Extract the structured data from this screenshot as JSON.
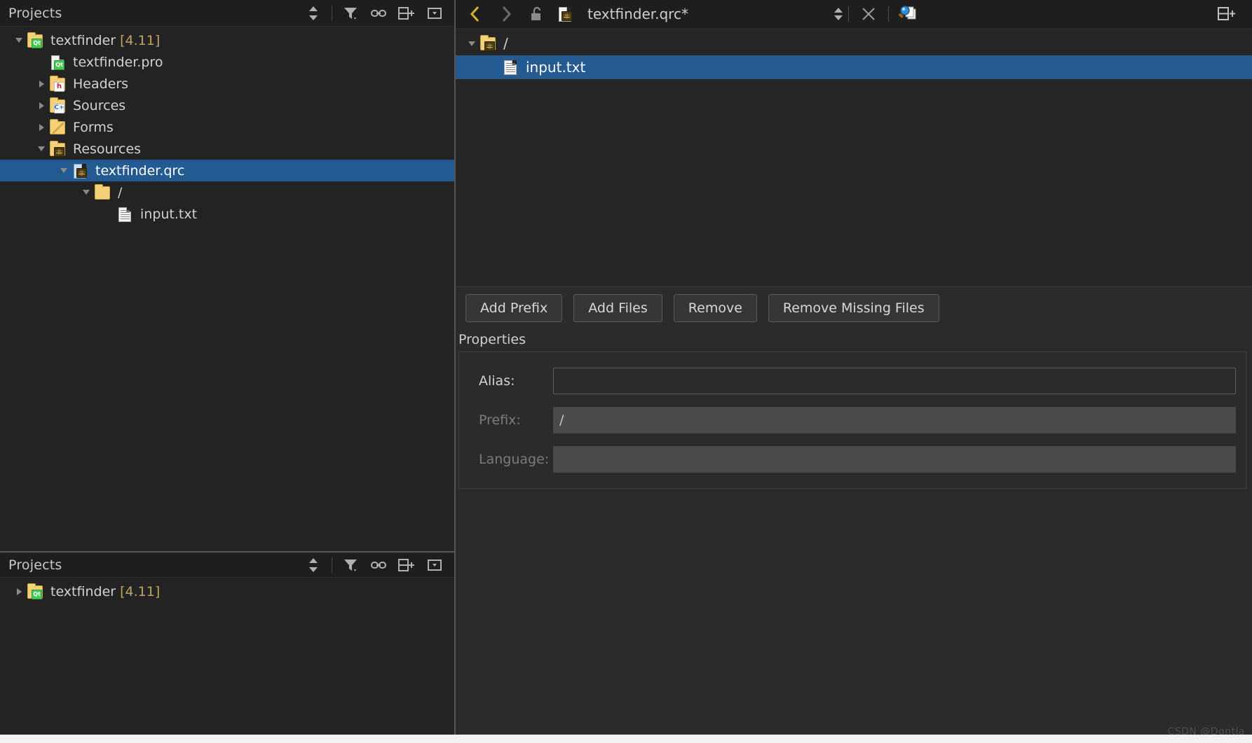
{
  "left_panel": {
    "title": "Projects",
    "header_icons": [
      "sync-arrows-icon",
      "filter-icon",
      "link-icon",
      "split-add-icon"
    ],
    "tree": [
      {
        "label": "textfinder ",
        "version": "[4.11]",
        "icon": "qt-project-folder-icon",
        "arrow": "expanded",
        "indent": 0,
        "selected": false
      },
      {
        "label": "textfinder.pro",
        "version": "",
        "icon": "qt-pro-file-icon",
        "arrow": "none",
        "indent": 1,
        "selected": false
      },
      {
        "label": "Headers",
        "version": "",
        "icon": "headers-folder-icon",
        "arrow": "collapsed",
        "indent": 1,
        "selected": false
      },
      {
        "label": "Sources",
        "version": "",
        "icon": "sources-folder-icon",
        "arrow": "collapsed",
        "indent": 1,
        "selected": false
      },
      {
        "label": "Forms",
        "version": "",
        "icon": "forms-folder-icon",
        "arrow": "collapsed",
        "indent": 1,
        "selected": false
      },
      {
        "label": "Resources",
        "version": "",
        "icon": "resources-folder-icon",
        "arrow": "expanded",
        "indent": 1,
        "selected": false
      },
      {
        "label": "textfinder.qrc",
        "version": "",
        "icon": "qrc-file-icon",
        "arrow": "expanded",
        "indent": 2,
        "selected": true
      },
      {
        "label": "/",
        "version": "",
        "icon": "plain-folder-icon",
        "arrow": "expanded",
        "indent": 3,
        "selected": false
      },
      {
        "label": "input.txt",
        "version": "",
        "icon": "text-file-icon",
        "arrow": "none",
        "indent": 4,
        "selected": false
      }
    ]
  },
  "left_panel_bottom": {
    "title": "Projects",
    "header_icons": [
      "sync-arrows-icon",
      "filter-icon",
      "link-icon",
      "split-add-icon",
      "menu-dropdown-icon"
    ],
    "tree": [
      {
        "label": "textfinder ",
        "version": "[4.11]",
        "icon": "qt-project-folder-icon",
        "arrow": "collapsed",
        "indent": 0,
        "selected": false
      }
    ]
  },
  "editor": {
    "toolbar": {
      "back_icon": "chevron-left-icon",
      "forward_icon": "chevron-right-icon",
      "lock_icon": "unlocked-padlock-icon",
      "document_icon": "qrc-file-icon",
      "document_name": "textfinder.qrc*",
      "combo_arrows_icon": "updown-arrows-icon",
      "close_icon": "close-x-icon",
      "search_icon": "find-in-document-icon",
      "split_icon": "split-view-add-icon"
    },
    "resource_tree": [
      {
        "label": "/",
        "icon": "qrc-prefix-folder-icon",
        "arrow": "expanded",
        "indent": 0,
        "selected": false
      },
      {
        "label": "input.txt",
        "icon": "text-file-icon",
        "arrow": "none",
        "indent": 1,
        "selected": true
      }
    ],
    "buttons": [
      {
        "label": "Add Prefix",
        "name": "add-prefix-button"
      },
      {
        "label": "Add Files",
        "name": "add-files-button"
      },
      {
        "label": "Remove",
        "name": "remove-button"
      },
      {
        "label": "Remove Missing Files",
        "name": "remove-missing-files-button"
      }
    ],
    "properties": {
      "section_label": "Properties",
      "fields": [
        {
          "label": "Alias:",
          "value": "",
          "disabled": false,
          "name": "alias"
        },
        {
          "label": "Prefix:",
          "value": "/",
          "disabled": true,
          "name": "prefix"
        },
        {
          "label": "Language:",
          "value": "",
          "disabled": true,
          "name": "language"
        }
      ]
    }
  },
  "watermark": "CSDN @Dontla",
  "colors": {
    "selection_blue": "#255a91",
    "panel_bg": "#232323",
    "toolbar_bg": "#1e1e1e",
    "accent_yellow": "#c2a368"
  }
}
